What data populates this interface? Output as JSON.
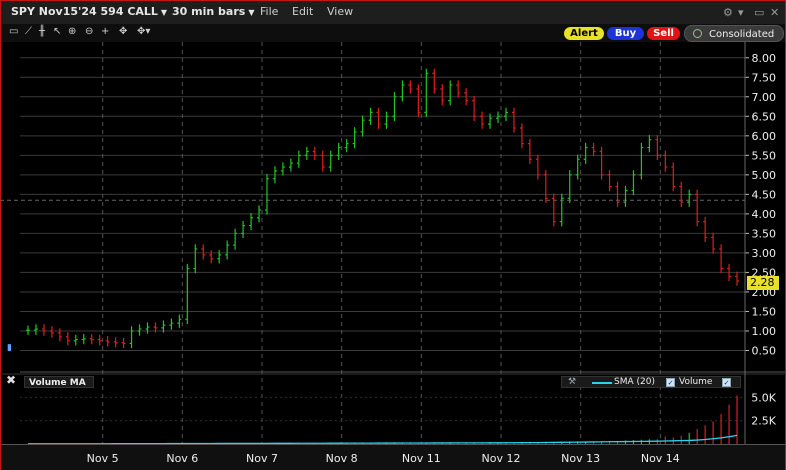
{
  "window": {
    "contract": "SPY Nov15'24 594 CALL",
    "timeframe": "30 min bars",
    "menu": [
      "File",
      "Edit",
      "View"
    ],
    "controls": [
      "⚙",
      "▾",
      "▭",
      "✕"
    ]
  },
  "toolbar": {
    "tools": [
      "cursor-icon",
      "line-icon",
      "pointer-icon",
      "zoom-in-icon",
      "zoom-out-icon",
      "crosshair-icon",
      "move-icon",
      "move-menu-icon"
    ]
  },
  "order_buttons": {
    "alert": "Alert",
    "buy": "Buy",
    "sell": "Sell",
    "feed": "Consolidated"
  },
  "colors": {
    "up": "#21c521",
    "down": "#e01c1c",
    "grid": "#3a3a3a",
    "sma": "#2ad4f0",
    "last_price_bg": "#e8e02a",
    "frame": "#c81414"
  },
  "last_price": "2.28",
  "volume_panel": {
    "title": "Volume MA",
    "sma_label": "SMA (20)",
    "volume_label": "Volume",
    "ticks": [
      "5.0K",
      "2.5K"
    ]
  },
  "chart_data": {
    "type": "candlestick",
    "x_labels": [
      "Nov 5",
      "Nov 6",
      "Nov 7",
      "Nov 8",
      "Nov 11",
      "Nov 12",
      "Nov 13",
      "Nov 14"
    ],
    "y_ticks": [
      "8.00",
      "7.50",
      "7.00",
      "6.50",
      "6.00",
      "5.50",
      "5.00",
      "4.50",
      "4.00",
      "3.50",
      "3.00",
      "2.50",
      "2.00",
      "1.50",
      "1.00",
      "0.50"
    ],
    "ylim": [
      0.0,
      8.25
    ],
    "reference_line": 4.35,
    "bars_per_day": 10,
    "closes": [
      1.02,
      1.05,
      1.0,
      0.95,
      0.85,
      0.75,
      0.78,
      0.8,
      0.78,
      0.75,
      0.72,
      0.7,
      0.68,
      1.0,
      1.05,
      1.1,
      1.08,
      1.15,
      1.2,
      1.3,
      2.6,
      3.1,
      2.95,
      2.85,
      2.95,
      3.2,
      3.5,
      3.7,
      3.9,
      4.1,
      4.9,
      5.1,
      5.2,
      5.3,
      5.5,
      5.6,
      5.5,
      5.2,
      5.5,
      5.7,
      5.8,
      6.1,
      6.4,
      6.6,
      6.3,
      6.5,
      7.0,
      7.3,
      7.2,
      6.6,
      7.6,
      7.2,
      6.9,
      7.3,
      7.1,
      6.9,
      6.5,
      6.3,
      6.45,
      6.5,
      6.6,
      6.2,
      5.8,
      5.4,
      5.0,
      4.4,
      3.8,
      4.4,
      5.0,
      5.4,
      5.7,
      5.6,
      5.0,
      4.7,
      4.3,
      4.6,
      5.0,
      5.7,
      5.9,
      5.5,
      5.2,
      4.7,
      4.3,
      4.5,
      3.8,
      3.4,
      3.1,
      2.6,
      2.4,
      2.28
    ],
    "volume": [
      20,
      15,
      18,
      12,
      10,
      14,
      16,
      12,
      10,
      22,
      25,
      20,
      18,
      30,
      28,
      35,
      40,
      38,
      42,
      45,
      80,
      60,
      55,
      50,
      48,
      52,
      60,
      70,
      65,
      58,
      120,
      80,
      70,
      90,
      85,
      75,
      70,
      80,
      85,
      90,
      95,
      100,
      110,
      120,
      100,
      90,
      115,
      130,
      140,
      120,
      150,
      130,
      120,
      140,
      125,
      110,
      100,
      95,
      90,
      85,
      180,
      140,
      160,
      170,
      190,
      260,
      230,
      240,
      280,
      300,
      250,
      260,
      300,
      320,
      350,
      380,
      420,
      460,
      500,
      520,
      800,
      700,
      900,
      1200,
      1600,
      2000,
      2400,
      3200,
      4200,
      5200
    ],
    "sma_volume": [
      20,
      20,
      20,
      20,
      20,
      20,
      22,
      24,
      26,
      28,
      30,
      32,
      34,
      36,
      38,
      40,
      42,
      44,
      46,
      48,
      50,
      52,
      54,
      56,
      58,
      60,
      62,
      64,
      66,
      68,
      70,
      72,
      74,
      76,
      78,
      80,
      82,
      84,
      86,
      88,
      90,
      92,
      94,
      96,
      98,
      100,
      102,
      104,
      106,
      108,
      110,
      112,
      114,
      116,
      118,
      120,
      122,
      124,
      126,
      128,
      130,
      135,
      140,
      145,
      150,
      160,
      170,
      180,
      190,
      200,
      210,
      220,
      230,
      240,
      250,
      260,
      270,
      280,
      290,
      300,
      320,
      340,
      360,
      380,
      420,
      480,
      560,
      660,
      780,
      920
    ]
  }
}
